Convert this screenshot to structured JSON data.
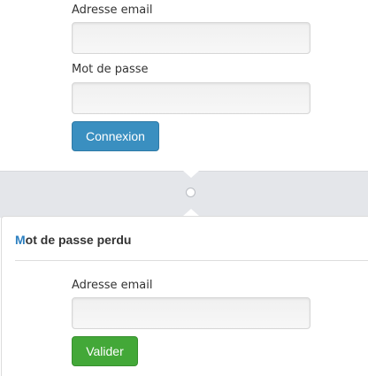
{
  "login_form": {
    "email_label": "Adresse email",
    "email_value": "",
    "password_label": "Mot de passe",
    "password_value": "",
    "submit_label": "Connexion"
  },
  "separator": {
    "icon": "circle-icon"
  },
  "lost_password": {
    "title_first_letter": "M",
    "title_rest": "ot de passe perdu",
    "email_label": "Adresse email",
    "email_value": "",
    "submit_label": "Valider"
  },
  "colors": {
    "primary_button": "#3a8fc0",
    "success_button": "#43a838",
    "title_accent": "#2b7fc0",
    "band_background": "#e4e6ea"
  }
}
